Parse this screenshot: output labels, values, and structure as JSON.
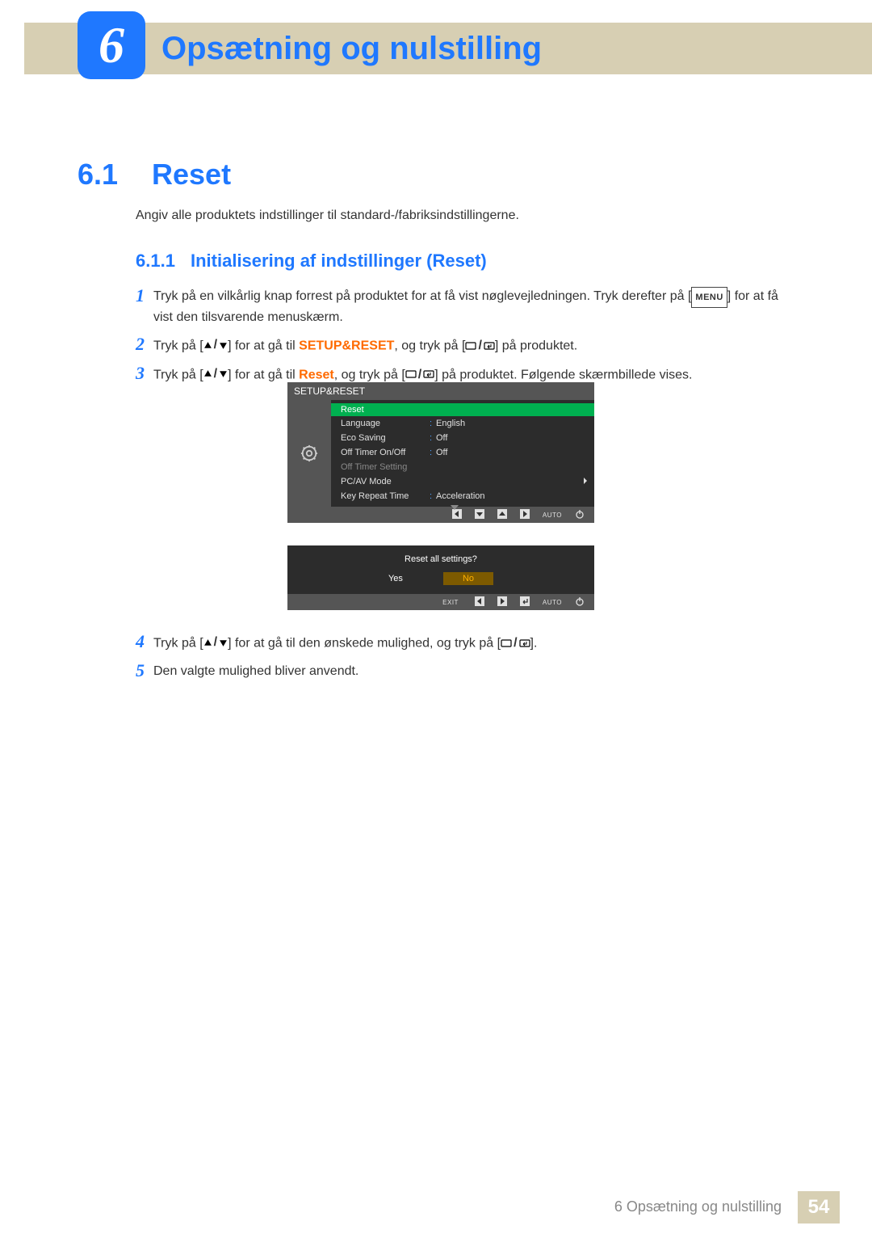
{
  "chapter": {
    "number": "6",
    "title": "Opsætning og nulstilling"
  },
  "section": {
    "number": "6.1",
    "title": "Reset"
  },
  "intro": "Angiv alle produktets indstillinger til standard-/fabriksindstillingerne.",
  "subsection": {
    "number": "6.1.1",
    "title": "Initialisering af indstillinger (Reset)"
  },
  "inline": {
    "menu_label": "MENU",
    "setup_reset": "SETUP&RESET",
    "reset": "Reset"
  },
  "steps": {
    "s1": {
      "num": "1",
      "a": "Tryk på en vilkårlig knap forrest på produktet for at få vist nøglevejledningen. Tryk derefter på [",
      "b": "] for at få vist den tilsvarende menuskærm."
    },
    "s2": {
      "num": "2",
      "a": "Tryk på [",
      "b": "] for at gå til ",
      "c": ", og tryk på [",
      "d": "] på produktet."
    },
    "s3": {
      "num": "3",
      "a": "Tryk på [",
      "b": "] for at gå til ",
      "c": ", og tryk på [",
      "d": "] på produktet. Følgende skærmbillede vises."
    },
    "s4": {
      "num": "4",
      "a": "Tryk på [",
      "b": "] for at gå til den ønskede mulighed, og tryk på [",
      "c": "]."
    },
    "s5": {
      "num": "5",
      "text": "Den valgte mulighed bliver anvendt."
    }
  },
  "osd1": {
    "title": "SETUP&RESET",
    "rows": [
      {
        "label": "Reset",
        "value": "",
        "selected": true
      },
      {
        "label": "Language",
        "value": "English"
      },
      {
        "label": "Eco Saving",
        "value": "Off"
      },
      {
        "label": "Off Timer On/Off",
        "value": "Off"
      },
      {
        "label": "Off Timer Setting",
        "value": "",
        "dimmed": true
      },
      {
        "label": "PC/AV Mode",
        "value": "",
        "chevron": true
      },
      {
        "label": "Key Repeat Time",
        "value": "Acceleration"
      }
    ],
    "bottom": {
      "auto": "AUTO"
    }
  },
  "osd2": {
    "question": "Reset all settings?",
    "yes": "Yes",
    "no": "No",
    "exit": "EXIT",
    "auto": "AUTO"
  },
  "footer": {
    "text": "6 Opsætning og nulstilling",
    "page": "54"
  }
}
